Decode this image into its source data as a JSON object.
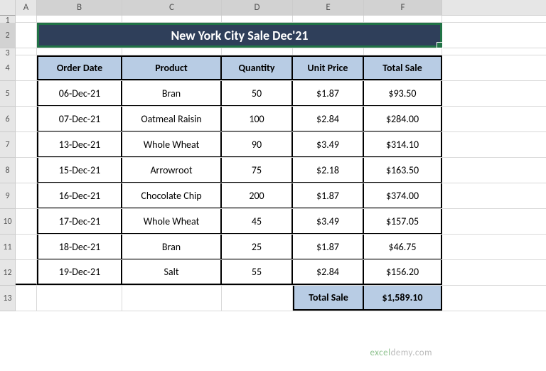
{
  "columns": [
    "",
    "A",
    "B",
    "C",
    "D",
    "E",
    "F"
  ],
  "rows": [
    "1",
    "2",
    "3",
    "4",
    "5",
    "6",
    "7",
    "8",
    "9",
    "10",
    "11",
    "12",
    "13"
  ],
  "title": "New York City Sale Dec'21",
  "headers": {
    "order_date": "Order Date",
    "product": "Product",
    "quantity": "Quantity",
    "unit_price": "Unit Price",
    "total_sale": "Total Sale"
  },
  "data": [
    {
      "date": "06-Dec-21",
      "product": "Bran",
      "qty": "50",
      "price": "$1.87",
      "total": "$93.50"
    },
    {
      "date": "07-Dec-21",
      "product": "Oatmeal Raisin",
      "qty": "100",
      "price": "$2.84",
      "total": "$284.00"
    },
    {
      "date": "13-Dec-21",
      "product": "Whole Wheat",
      "qty": "90",
      "price": "$3.49",
      "total": "$314.10"
    },
    {
      "date": "15-Dec-21",
      "product": "Arrowroot",
      "qty": "75",
      "price": "$2.18",
      "total": "$163.50"
    },
    {
      "date": "16-Dec-21",
      "product": "Chocolate Chip",
      "qty": "200",
      "price": "$1.87",
      "total": "$374.00"
    },
    {
      "date": "17-Dec-21",
      "product": "Whole Wheat",
      "qty": "45",
      "price": "$3.49",
      "total": "$157.05"
    },
    {
      "date": "18-Dec-21",
      "product": "Bran",
      "qty": "25",
      "price": "$1.87",
      "total": "$46.75"
    },
    {
      "date": "19-Dec-21",
      "product": "Salt",
      "qty": "55",
      "price": "$2.84",
      "total": "$156.20"
    }
  ],
  "totals": {
    "label": "Total Sale",
    "value": "$1,589.10"
  },
  "watermark": {
    "brand1": "excel",
    "brand2": "demy",
    "suffix": ".com"
  },
  "chart_data": {
    "type": "table",
    "title": "New York City Sale Dec'21",
    "columns": [
      "Order Date",
      "Product",
      "Quantity",
      "Unit Price",
      "Total Sale"
    ],
    "rows": [
      [
        "06-Dec-21",
        "Bran",
        50,
        1.87,
        93.5
      ],
      [
        "07-Dec-21",
        "Oatmeal Raisin",
        100,
        2.84,
        284.0
      ],
      [
        "13-Dec-21",
        "Whole Wheat",
        90,
        3.49,
        314.1
      ],
      [
        "15-Dec-21",
        "Arrowroot",
        75,
        2.18,
        163.5
      ],
      [
        "16-Dec-21",
        "Chocolate Chip",
        200,
        1.87,
        374.0
      ],
      [
        "17-Dec-21",
        "Whole Wheat",
        45,
        3.49,
        157.05
      ],
      [
        "18-Dec-21",
        "Bran",
        25,
        1.87,
        46.75
      ],
      [
        "19-Dec-21",
        "Salt",
        55,
        2.84,
        156.2
      ]
    ],
    "grand_total": 1589.1
  }
}
